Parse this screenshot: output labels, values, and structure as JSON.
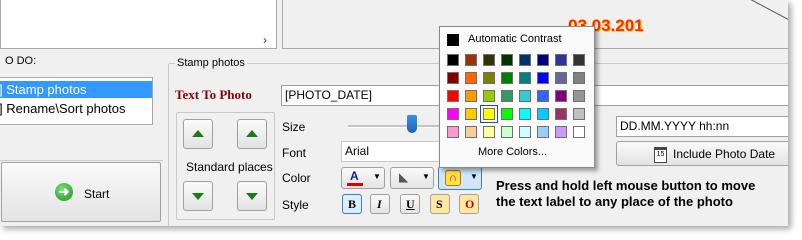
{
  "preview": {
    "date_text": "03.03.201"
  },
  "todo": {
    "title": "O DO:",
    "items": [
      {
        "label": "Stamp photos"
      },
      {
        "label": "Rename\\Sort photos"
      }
    ],
    "start_label": "Start"
  },
  "stamp": {
    "group_title": "Stamp photos",
    "text_to_photo_label": "Text To Photo",
    "text_value": "[PHOTO_DATE]",
    "standard_places_label": "Standard places",
    "size_label": "Size",
    "font_label": "Font",
    "font_value": "Arial",
    "color_label": "Color",
    "style_label": "Style",
    "style_buttons": [
      "B",
      "I",
      "U",
      "S",
      "O"
    ],
    "date_format_value": "DD.MM.YYYY hh:nn",
    "include_date_label": "Include Photo Date",
    "instruction_line1": "Press and hold left mouse button to move",
    "instruction_line2": "the text label to any place of the photo",
    "size_slider_fraction": 0.31
  },
  "color_popup": {
    "automatic_label": "Automatic Contrast",
    "more_label": "More Colors...",
    "selected": "#ffff00",
    "rows": [
      [
        "#000000",
        "#993300",
        "#333300",
        "#003300",
        "#003366",
        "#000080",
        "#333399",
        "#333333"
      ],
      [
        "#800000",
        "#ff6600",
        "#808000",
        "#008000",
        "#008080",
        "#0000ff",
        "#666699",
        "#808080"
      ],
      [
        "#ff0000",
        "#ff9900",
        "#99cc00",
        "#339966",
        "#33cccc",
        "#3366ff",
        "#800080",
        "#969696"
      ],
      [
        "#ff00ff",
        "#ffcc00",
        "#ffff00",
        "#00ff00",
        "#00ffff",
        "#00ccff",
        "#993366",
        "#c0c0c0"
      ],
      [
        "#ff99cc",
        "#ffcc99",
        "#ffff99",
        "#ccffcc",
        "#ccffff",
        "#99ccff",
        "#cc99ff",
        "#ffffff"
      ]
    ]
  },
  "colors": {
    "accent": "#3399ff",
    "heading": "#8b0000"
  }
}
